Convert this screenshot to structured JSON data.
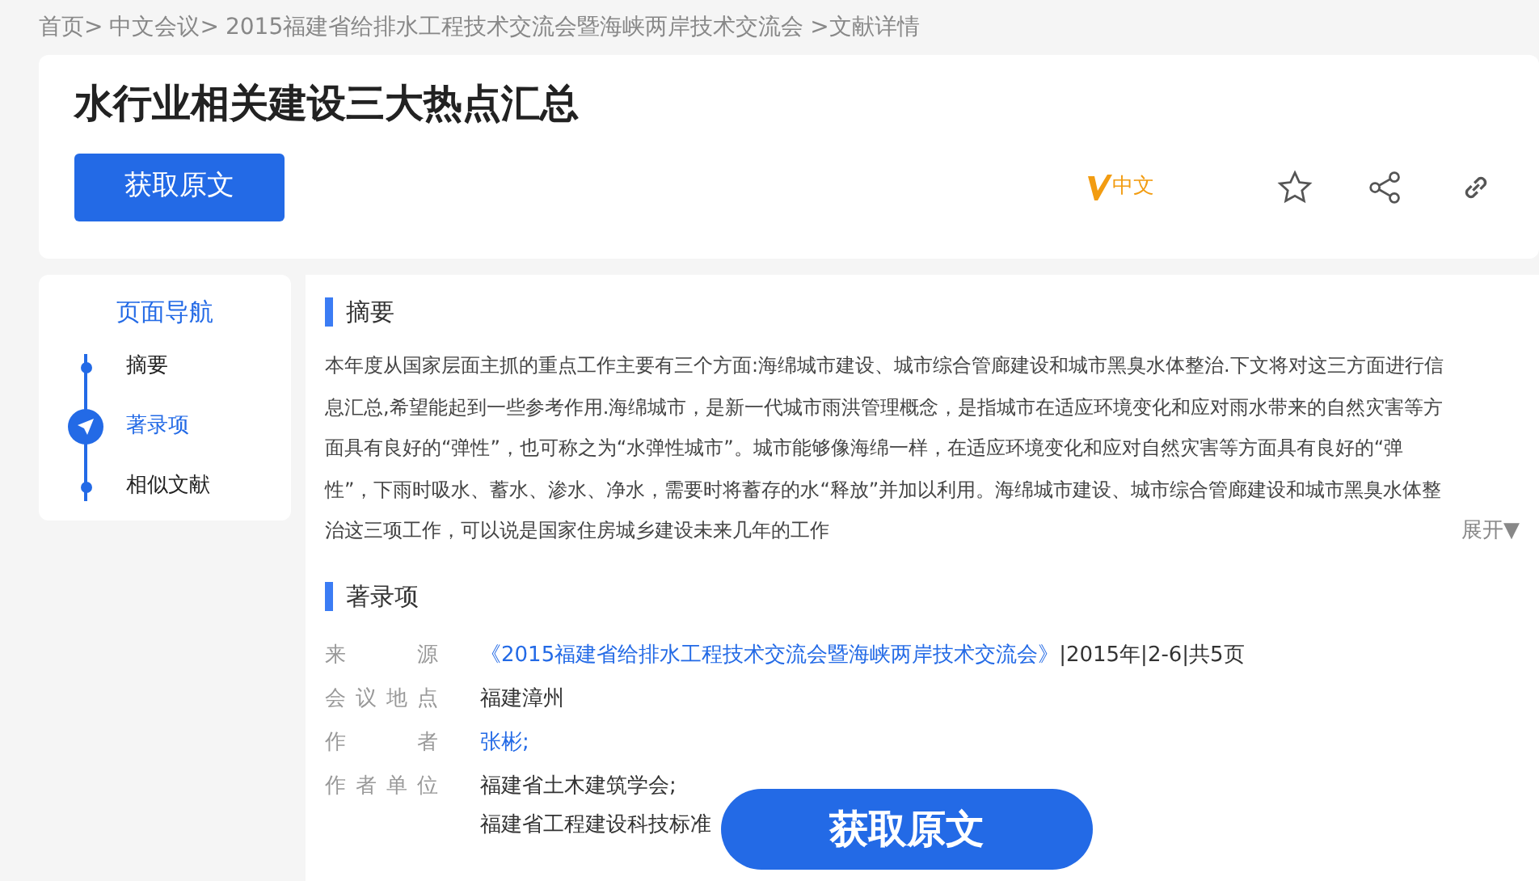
{
  "breadcrumb": [
    "首页>",
    "中文会议>",
    "2015福建省给排水工程技术交流会暨海峡两岸技术交流会",
    ">文献详情"
  ],
  "title": "水行业相关建设三大热点汇总",
  "get_button": "获取原文",
  "language_badge": "中文",
  "nav": {
    "title": "页面导航",
    "items": [
      {
        "label": "摘要",
        "selected": false
      },
      {
        "label": "著录项",
        "selected": true
      },
      {
        "label": "相似文献",
        "selected": false
      }
    ]
  },
  "abstract": {
    "heading": "摘要",
    "text": "本年度从国家层面主抓的重点工作主要有三个方面:海绵城市建设、城市综合管廊建设和城市黑臭水体整治.下文将对这三方面进行信息汇总,希望能起到一些参考作用.海绵城市，是新一代城市雨洪管理概念，是指城市在适应环境变化和应对雨水带来的自然灾害等方面具有良好的“弹性”，也可称之为“水弹性城市”。城市能够像海绵一样，在适应环境变化和应对自然灾害等方面具有良好的“弹性”，下雨时吸水、蓄水、渗水、净水，需要时将蓄存的水“释放”并加以利用。海绵城市建设、城市综合管廊建设和城市黑臭水体整治这三项工作，可以说是国家住房城乡建设未来几年的工作",
    "expand": "展开▼"
  },
  "record": {
    "heading": "著录项",
    "rows": [
      {
        "label": "来源",
        "kind": "source",
        "link": "《2015福建省给排水工程技术交流会暨海峡两岸技术交流会》",
        "extra": "|2015年|2-6|共5页"
      },
      {
        "label": "会议地点",
        "kind": "text",
        "lines": [
          "福建漳州"
        ]
      },
      {
        "label": "作者",
        "kind": "link",
        "lines": [
          "张彬;"
        ]
      },
      {
        "label": "作者单位",
        "kind": "text",
        "lines": [
          "福建省土木建筑学会;",
          "福建省工程建设科技标准"
        ]
      }
    ]
  },
  "floating_button": "获取原文"
}
